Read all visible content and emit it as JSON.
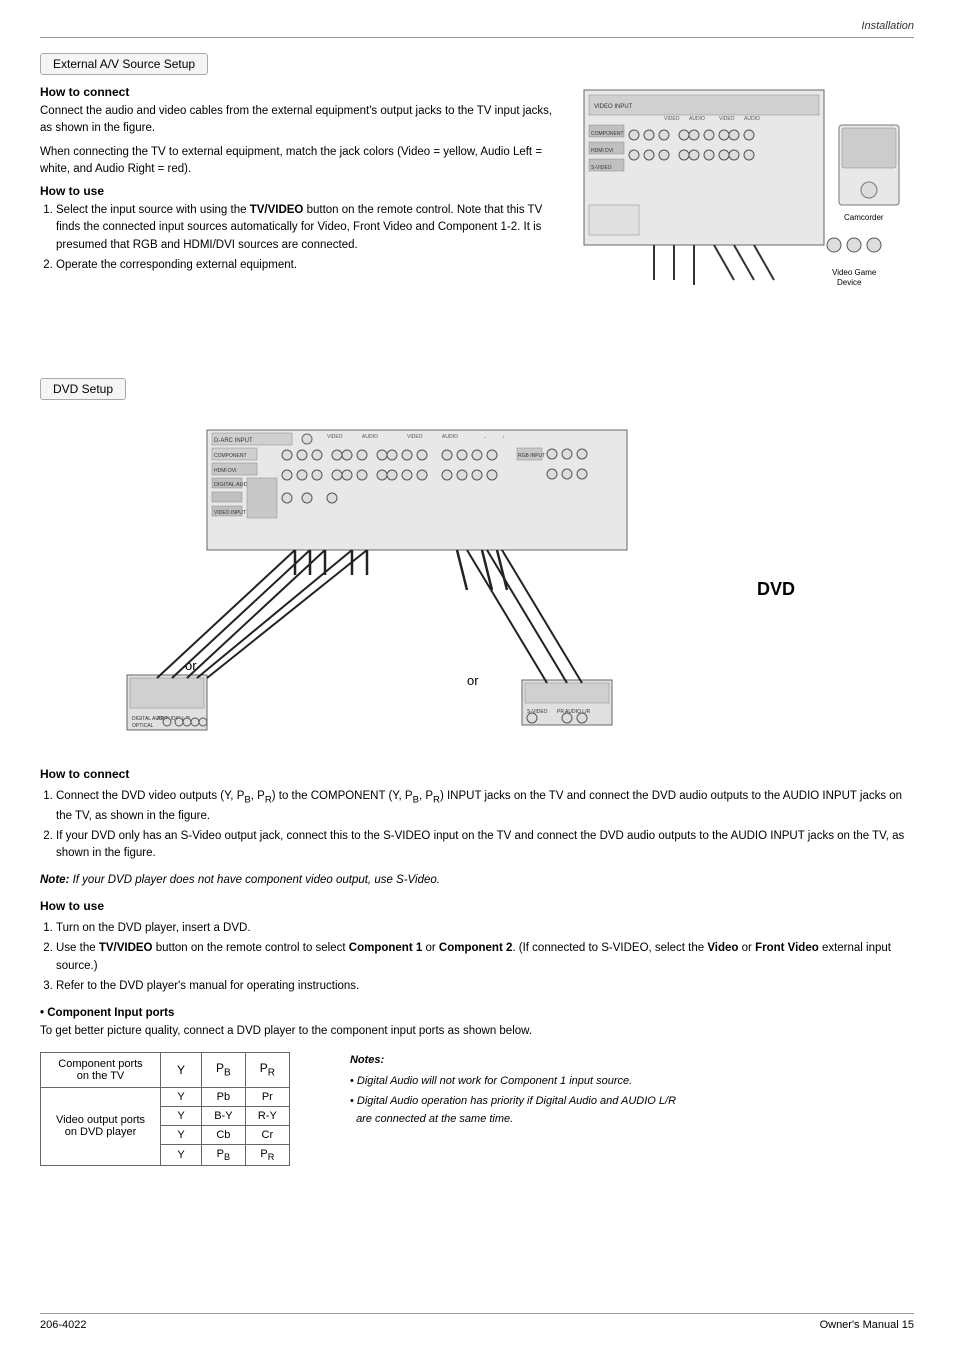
{
  "header": {
    "section": "Installation",
    "footer_left": "206-4022",
    "footer_right": "Owner's Manual   15"
  },
  "external_av": {
    "section_title": "External A/V Source Setup",
    "how_to_connect_title": "How to connect",
    "how_to_connect_text1": "Connect the audio and video cables from the external equipment's output jacks to the TV input jacks, as shown in the figure.",
    "how_to_connect_text2": "When connecting the TV to external equipment, match the jack colors (Video = yellow, Audio Left = white, and Audio Right = red).",
    "how_to_use_title": "How to use",
    "how_to_use_items": [
      "Select the input source with using the TV/VIDEO button on the remote control. Note that this TV finds the connected input sources automatically for Video, Front Video and Component 1-2. It is presumed that RGB and HDMI/DVI sources are connected.",
      "Operate the corresponding external equipment."
    ],
    "camcorder_label": "Camcorder",
    "video_game_label": "Video Game\nDevice"
  },
  "dvd": {
    "section_title": "DVD Setup",
    "dvd_label": "DVD",
    "how_to_connect_title": "How to connect",
    "how_to_connect_items": [
      "Connect the DVD video outputs (Y, PB, PR) to the COMPONENT (Y, PB, PR) INPUT jacks  on the TV and connect the DVD audio outputs to the AUDIO INPUT jacks on the TV, as shown in the figure.",
      "If your DVD only has an S-Video output jack, connect this to the S-VIDEO input on the TV and connect the DVD audio outputs to the AUDIO INPUT jacks on the TV, as shown in the figure."
    ],
    "note_text": "Note: If your DVD player does not have component video output, use S-Video.",
    "how_to_use_title": "How to use",
    "how_to_use_items": [
      "Turn on the DVD player, insert a DVD.",
      "Use the TV/VIDEO button on the remote control to select Component 1 or Component 2.  (If connected to S-VIDEO, select the Video or Front Video external input source.)",
      "Refer to the DVD player's manual for operating instructions."
    ],
    "component_input_title": "Component Input ports",
    "component_input_desc": "To get better picture quality, connect a DVD player to the component input ports as shown below.",
    "table": {
      "row1_label": "Component ports\non the TV",
      "row1_cols": [
        "Y",
        "PB",
        "PR"
      ],
      "row2_label": "Video output ports\non DVD player",
      "row2_cols": [
        [
          "Y",
          "Y",
          "Y",
          "Y"
        ],
        [
          "Pb",
          "B-Y",
          "Cb",
          "PB"
        ],
        [
          "Pr",
          "R-Y",
          "Cr",
          "PR"
        ]
      ]
    },
    "notes_title": "Notes:",
    "notes_items": [
      "Digital Audio will not work for Component 1 input source.",
      "Digital Audio operation has priority if Digital Audio and AUDIO L/R are connected at the same time."
    ]
  }
}
